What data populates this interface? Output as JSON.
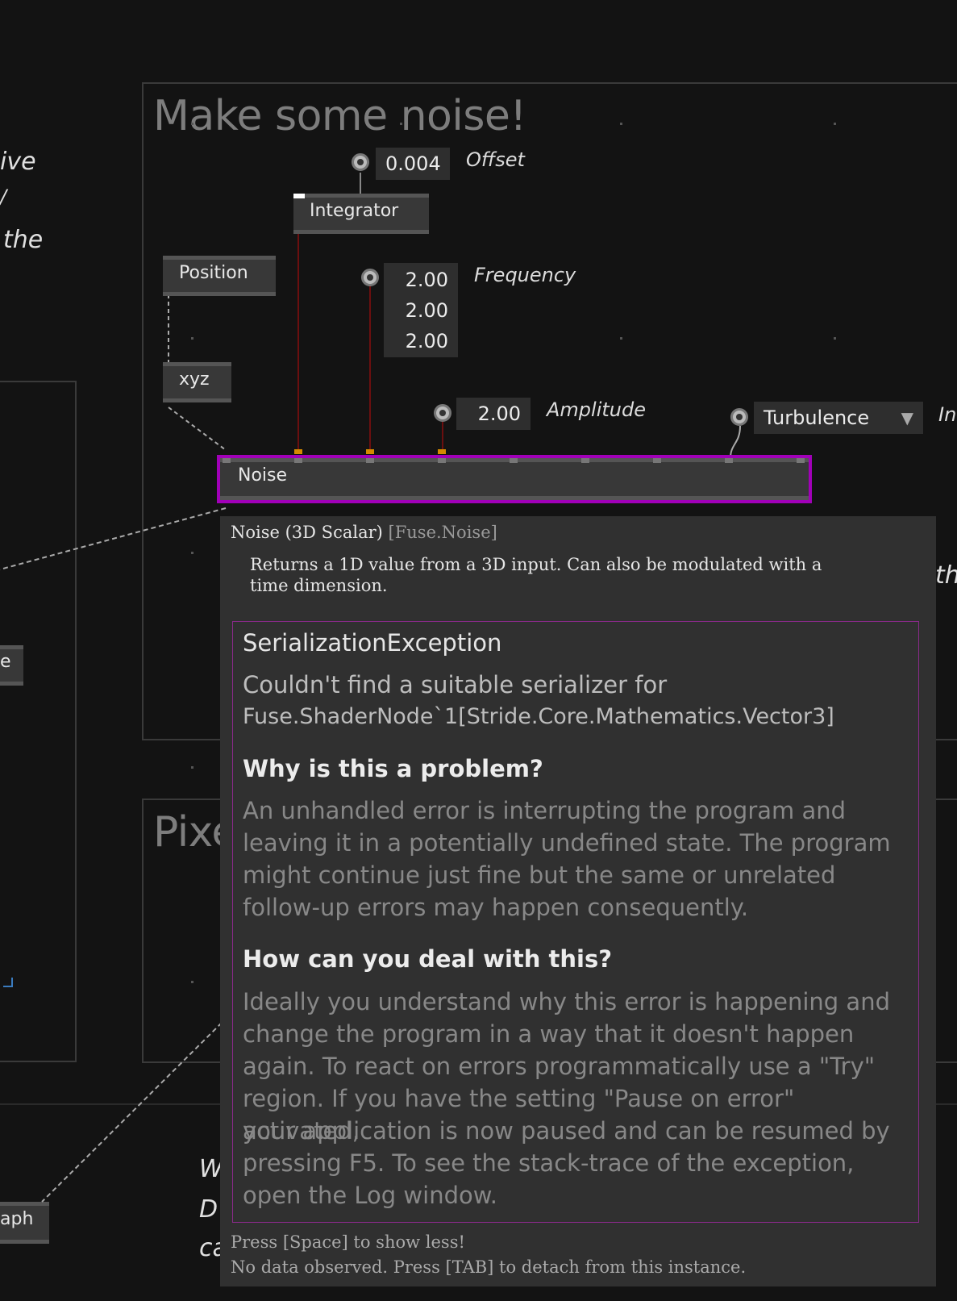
{
  "side_text": {
    "line1": "ive",
    "line2": "/",
    "line3": "the",
    "left_node": "e",
    "bottom_node": "aph",
    "bottom_w": "W",
    "bottom_d": "D",
    "bottom_c": "ca",
    "right_in": "In",
    "right_th": "th"
  },
  "region_noise": {
    "title": "Make some noise!"
  },
  "region_pixels": {
    "title": "Pixe"
  },
  "nodes": {
    "integrator": "Integrator",
    "position": "Position",
    "xyz": "xyz",
    "noise": "Noise"
  },
  "ioboxes": {
    "offset_value": "0.004",
    "offset_label": "Offset",
    "frequency_values": [
      "2.00",
      "2.00",
      "2.00"
    ],
    "frequency_label": "Frequency",
    "amplitude_value": "2.00",
    "amplitude_label": "Amplitude",
    "turbulence_value": "Turbulence"
  },
  "tooltip": {
    "node_name": "Noise (3D Scalar)",
    "node_type": "[Fuse.Noise]",
    "description_1": "Returns a 1D value from a 3D input.  Can also be modulated with a",
    "description_2": "time dimension.",
    "error_title": "SerializationException",
    "error_message_1": "Couldn't find a suitable serializer for",
    "error_message_2": "Fuse.ShaderNode`1[Stride.Core.Mathematics.Vector3]",
    "why_heading": "Why is this a problem?",
    "why_lines": [
      "An unhandled error is interrupting the program and",
      "leaving it in a potentially undefined state. The program",
      "might continue just fine but the same or unrelated",
      "follow-up errors may happen consequently."
    ],
    "how_heading": "How can you deal with this?",
    "how_lines": [
      "Ideally you understand why this error is happening and",
      "change the program in a way that it doesn't happen",
      "again. To react on errors programmatically use a \"Try\"",
      "region. If you have the setting \"Pause on error\" activated,",
      "your application is now paused and can be resumed by",
      "pressing F5. To see the stack-trace of the exception,",
      "open the Log window."
    ],
    "footer_1": "Press [Space] to show less!",
    "footer_2": "No data observed. Press [TAB] to detach from this instance."
  },
  "colors": {
    "background": "#131313",
    "selection": "#a100b8",
    "error_border": "#8a2a8a",
    "pin_active": "#d58a00"
  }
}
